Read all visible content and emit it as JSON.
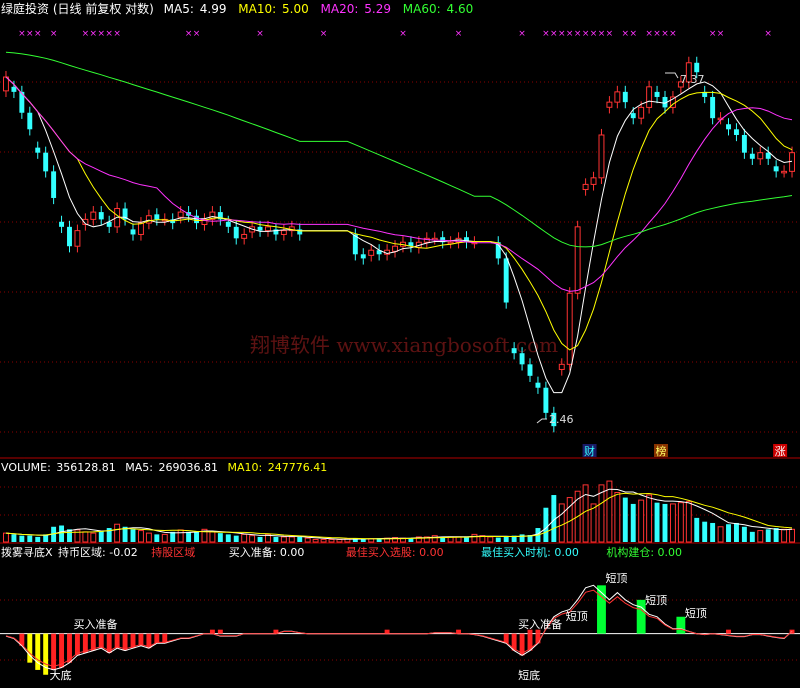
{
  "header": {
    "stock": "绿庭投资",
    "period": "(日线 前复权 对数)",
    "ma": [
      {
        "label": "MA5:",
        "value": "4.99",
        "color": "#ffffff"
      },
      {
        "label": "MA10:",
        "value": "5.00",
        "color": "#ffff00"
      },
      {
        "label": "MA20:",
        "value": "5.29",
        "color": "#ff33ff"
      },
      {
        "label": "MA60:",
        "value": "4.60",
        "color": "#33ff33"
      }
    ]
  },
  "price_panel": {
    "high_label": "7.37",
    "low_label": "2.46",
    "tags": [
      {
        "text": "财",
        "x": 74,
        "color": "#33ffff",
        "bg": "#1a1a66"
      },
      {
        "text": "榜",
        "x": 83,
        "color": "#ffff66",
        "bg": "#883300"
      },
      {
        "text": "涨",
        "x": 98,
        "color": "#ffffff",
        "bg": "#cc0000"
      }
    ],
    "watermark": "翔博软件 www.xiangbosoft.com"
  },
  "volume_panel": {
    "label": "VOLUME:",
    "value": "356128.81",
    "ma5_label": "MA5:",
    "ma5_value": "269036.81",
    "ma10_label": "MA10:",
    "ma10_value": "247776.41",
    "label_color": "#ffffff",
    "ma10_color": "#ffff00"
  },
  "indicator_panel": {
    "items": [
      {
        "text": "拨雾寻底X",
        "color": "#ffffff"
      },
      {
        "text": "持币区域: -0.02",
        "color": "#ffffff"
      },
      {
        "text": "持股区域",
        "color": "#ff3333"
      },
      {
        "text": "买入准备: 0.00",
        "color": "#ffffff"
      },
      {
        "text": "最佳买入选股: 0.00",
        "color": "#ff3333"
      },
      {
        "text": "最佳买入时机: 0.00",
        "color": "#33ffff"
      },
      {
        "text": "机构建仓: 0.00",
        "color": "#33ff33"
      }
    ],
    "labels": [
      {
        "text": "买入准备",
        "x": 9
      },
      {
        "text": "买入准备",
        "x": 65
      },
      {
        "text": "短顶",
        "x": 71
      },
      {
        "text": "短顶",
        "x": 76
      },
      {
        "text": "短顶",
        "x": 81
      },
      {
        "text": "短顶",
        "x": 86
      }
    ],
    "bottom_labels": [
      {
        "text": "大底",
        "x": 6
      },
      {
        "text": "短底",
        "x": 65
      }
    ]
  },
  "chart_data": {
    "type": "candlestick",
    "bars": 100,
    "price_range": [
      2.4,
      7.9
    ],
    "volume_range": [
      0,
      520000
    ],
    "osc_range": [
      -1.0,
      1.4
    ],
    "colors": {
      "up": "#ff3333",
      "down": "#33ffff",
      "ma5": "#ffffff",
      "ma10": "#ffff00",
      "ma20": "#ff33ff",
      "ma60": "#33ff33",
      "osc_line": "#ffffff",
      "grid": "#8b0000",
      "marker": "#ff33ff"
    },
    "marker_bars": [
      2,
      3,
      4,
      6,
      10,
      11,
      12,
      13,
      14,
      23,
      24,
      32,
      40,
      50,
      57,
      65,
      68,
      69,
      70,
      71,
      72,
      73,
      74,
      75,
      76,
      78,
      79,
      81,
      82,
      83,
      84,
      89,
      90,
      96
    ],
    "close": [
      7.0,
      6.7,
      6.3,
      6.0,
      5.6,
      5.3,
      4.9,
      4.5,
      4.25,
      4.45,
      4.6,
      4.7,
      4.6,
      4.5,
      4.75,
      4.6,
      4.4,
      4.55,
      4.65,
      4.6,
      4.6,
      4.55,
      4.7,
      4.65,
      4.55,
      4.6,
      4.7,
      4.6,
      4.5,
      4.35,
      4.4,
      4.5,
      4.45,
      4.5,
      4.4,
      4.45,
      4.5,
      4.4,
      null,
      null,
      null,
      null,
      null,
      null,
      4.15,
      4.1,
      4.2,
      4.15,
      4.2,
      4.25,
      4.3,
      4.25,
      4.3,
      4.35,
      4.35,
      4.3,
      4.3,
      4.35,
      4.3,
      4.3,
      null,
      null,
      4.1,
      3.6,
      3.1,
      3.0,
      2.9,
      2.8,
      2.6,
      2.5,
      3.0,
      3.7,
      4.5,
      5.1,
      5.2,
      5.9,
      6.5,
      6.7,
      6.5,
      6.2,
      6.4,
      6.8,
      6.6,
      6.4,
      6.6,
      6.9,
      7.3,
      7.1,
      6.6,
      6.2,
      6.2,
      6.0,
      5.9,
      5.6,
      5.5,
      5.6,
      5.5,
      5.3,
      5.3,
      5.6
    ],
    "volume": [
      70000,
      60000,
      50000,
      50000,
      40000,
      60000,
      120000,
      130000,
      100000,
      95000,
      80000,
      70000,
      90000,
      110000,
      140000,
      120000,
      100000,
      90000,
      70000,
      60000,
      60000,
      80000,
      95000,
      80000,
      80000,
      100000,
      80000,
      70000,
      60000,
      50000,
      60000,
      50000,
      40000,
      60000,
      40000,
      40000,
      40000,
      40000,
      30000,
      20000,
      20000,
      20000,
      20000,
      25000,
      30000,
      25000,
      25000,
      30000,
      30000,
      35000,
      30000,
      30000,
      40000,
      40000,
      50000,
      40000,
      40000,
      40000,
      40000,
      60000,
      50000,
      40000,
      35000,
      40000,
      50000,
      60000,
      55000,
      110000,
      270000,
      370000,
      300000,
      350000,
      400000,
      450000,
      300000,
      450000,
      480000,
      390000,
      350000,
      300000,
      330000,
      370000,
      310000,
      300000,
      300000,
      310000,
      320000,
      190000,
      160000,
      150000,
      120000,
      140000,
      150000,
      120000,
      80000,
      90000,
      100000,
      110000,
      100000,
      100000
    ],
    "osc": [
      -0.05,
      -0.1,
      -0.25,
      -0.45,
      -0.6,
      -0.7,
      -0.75,
      -0.7,
      -0.6,
      -0.45,
      -0.4,
      -0.35,
      -0.3,
      -0.4,
      -0.3,
      -0.35,
      -0.3,
      -0.25,
      -0.3,
      -0.2,
      -0.2,
      -0.15,
      -0.1,
      -0.1,
      -0.05,
      0.0,
      0.0,
      -0.05,
      -0.05,
      -0.05,
      0.0,
      0.0,
      0.0,
      0.0,
      0.0,
      0.05,
      0.05,
      0.02,
      0.0,
      0.0,
      0.0,
      0.0,
      0.0,
      0.0,
      0.0,
      0.0,
      0.0,
      0.0,
      0.0,
      0.0,
      0.0,
      0.0,
      0.0,
      0.0,
      0.02,
      0.02,
      0.02,
      0.0,
      0.0,
      -0.02,
      -0.05,
      -0.1,
      -0.15,
      -0.2,
      -0.35,
      -0.45,
      -0.35,
      -0.2,
      0.1,
      0.35,
      0.45,
      0.5,
      0.7,
      0.95,
      1.0,
      0.85,
      0.7,
      0.85,
      0.7,
      0.6,
      0.55,
      0.4,
      0.35,
      0.2,
      0.1,
      0.1,
      0.05,
      0.0,
      -0.02,
      0.0,
      -0.02,
      -0.04,
      -0.06,
      -0.06,
      -0.02,
      -0.02,
      -0.05,
      -0.08,
      -0.1,
      0.05
    ]
  }
}
